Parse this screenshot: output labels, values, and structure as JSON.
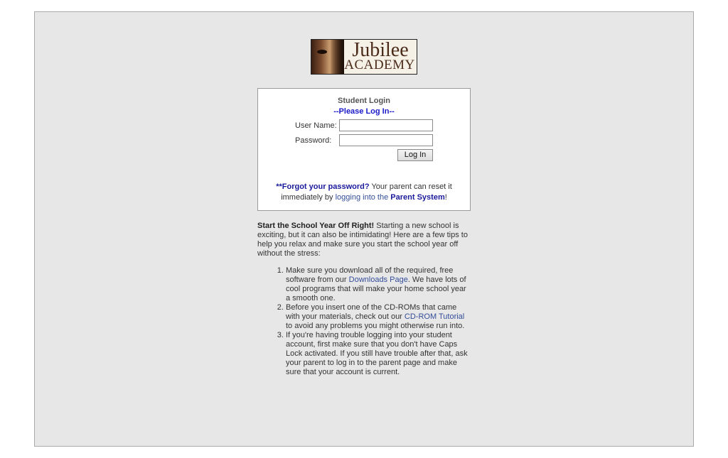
{
  "logo": {
    "name": "Jubilee",
    "sub": "ACADEMY"
  },
  "login": {
    "title": "Student Login",
    "subtitle": "--Please Log In--",
    "username_label": "User Name:",
    "username_value": "",
    "password_label": "Password:",
    "password_value": "",
    "button_label": "Log In",
    "forgot_link": "**Forgot your password?",
    "forgot_text_1": " Your parent can reset it immediately by ",
    "forgot_link_2": "logging into the",
    "forgot_text_2": " ",
    "forgot_link_3": "Parent System",
    "forgot_text_3": "!"
  },
  "content": {
    "intro_title": "Start the School Year Off Right!",
    "intro_text": " Starting a new school is exciting, but it can also be intimidating! Here are a few tips to help you relax and make sure you start the school year off without the stress:",
    "tips": [
      {
        "before": "Make sure you download all of the required, free software from our ",
        "link": "Downloads Page",
        "after": ". We have lots of cool programs that will make your home school year a smooth one."
      },
      {
        "before": "Before you insert one of the CD-ROMs that came with your materials, check out our ",
        "link": "CD-ROM Tutorial",
        "after": " to avoid any problems you might otherwise run into."
      },
      {
        "before": "If you're having trouble logging into your student account, first make sure that you don't have Caps Lock activated. If you still have trouble after that, ask your parent to log in to the parent page and make sure that your account is current.",
        "link": "",
        "after": ""
      }
    ]
  }
}
